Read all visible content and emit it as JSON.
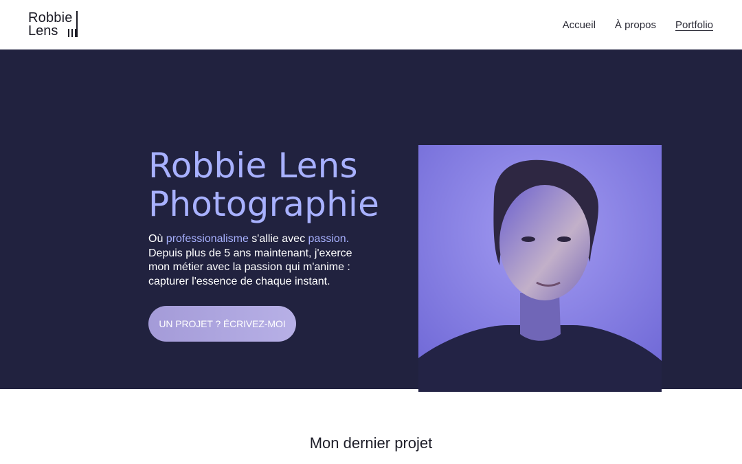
{
  "header": {
    "logo": {
      "line1": "Robbie",
      "line2": "Lens"
    },
    "nav": [
      {
        "label": "Accueil",
        "active": false
      },
      {
        "label": "À propos",
        "active": false
      },
      {
        "label": "Portfolio",
        "active": true
      }
    ]
  },
  "hero": {
    "title_line1": "Robbie Lens",
    "title_line2": "Photographie",
    "text_intro": "Où ",
    "text_highlight1": "professionalisme",
    "text_mid": " s'allie avec ",
    "text_highlight2": "passion",
    "text_end": ".",
    "text_body": "Depuis plus de 5 ans maintenant, j'exerce mon métier avec la passion qui m'anime : capturer l'essence de chaque instant.",
    "cta_label": "UN PROJET ? ÉCRIVEZ-MOI",
    "colors": {
      "background": "#21223f",
      "accent": "#a8b1ff"
    }
  },
  "section": {
    "title": "Mon dernier projet"
  }
}
